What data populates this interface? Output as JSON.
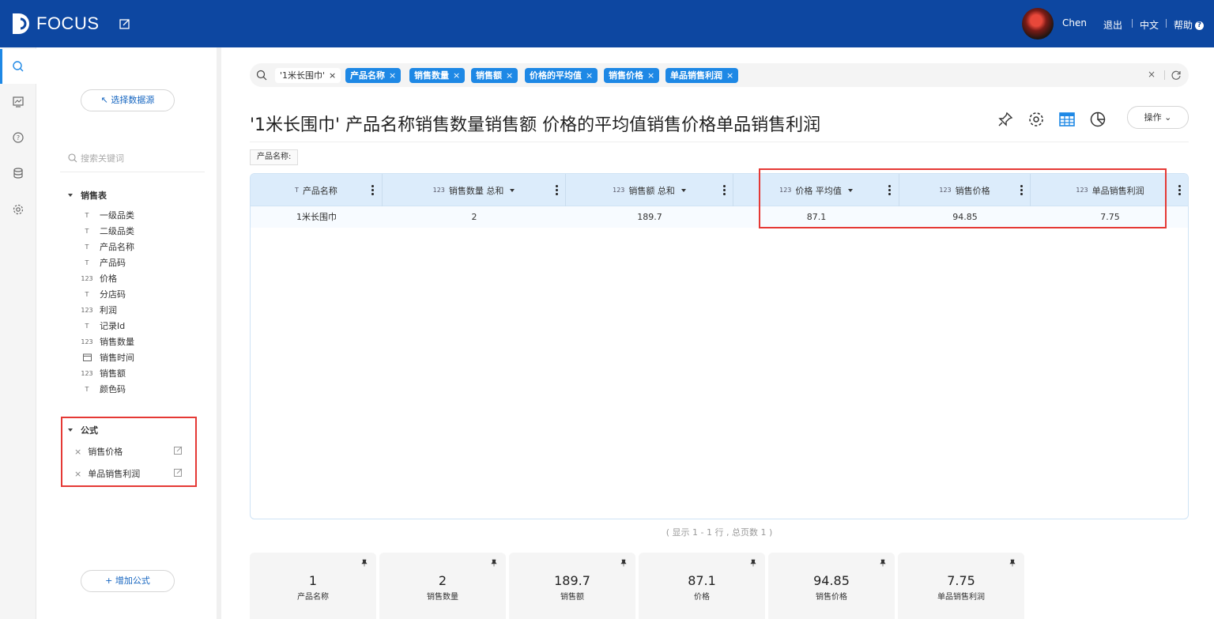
{
  "header": {
    "logo_text": "FOCUS",
    "user_name": "Chen",
    "logout": "退出",
    "language": "中文",
    "help": "帮助"
  },
  "sidebar": {
    "select_source": "↖ 选择数据源",
    "search_placeholder": "搜索关键词",
    "table_name": "销售表",
    "fields": [
      {
        "type": "text",
        "label": "一级品类"
      },
      {
        "type": "text",
        "label": "二级品类"
      },
      {
        "type": "text",
        "label": "产品名称"
      },
      {
        "type": "text",
        "label": "产品码"
      },
      {
        "type": "number",
        "label": "价格"
      },
      {
        "type": "text",
        "label": "分店码"
      },
      {
        "type": "number",
        "label": "利润"
      },
      {
        "type": "text",
        "label": "记录Id"
      },
      {
        "type": "number",
        "label": "销售数量"
      },
      {
        "type": "date",
        "label": "销售时间"
      },
      {
        "type": "number",
        "label": "销售额"
      },
      {
        "type": "text",
        "label": "颜色码"
      }
    ],
    "formula_section": "公式",
    "formulas": [
      "销售价格",
      "单品销售利润"
    ],
    "add_formula": "+ 增加公式"
  },
  "search": {
    "chips": [
      {
        "label": "'1米长围巾'",
        "style": "light"
      },
      {
        "label": "产品名称",
        "style": "blue"
      },
      {
        "label": "销售数量",
        "style": "blue"
      },
      {
        "label": "销售额",
        "style": "blue"
      },
      {
        "label": "价格的平均值",
        "style": "blue"
      },
      {
        "label": "销售价格",
        "style": "blue"
      },
      {
        "label": "单品销售利润",
        "style": "blue"
      }
    ],
    "clear": "×"
  },
  "main": {
    "title": "'1米长围巾' 产品名称销售数量销售额 价格的平均值销售价格单品销售利润",
    "ops_button": "操作",
    "filter_tag": "产品名称:"
  },
  "table": {
    "columns": [
      {
        "icon": "T",
        "label": "产品名称",
        "sort": false
      },
      {
        "icon": "123",
        "label": "销售数量 总和",
        "sort": true
      },
      {
        "icon": "123",
        "label": "销售额 总和",
        "sort": true
      },
      {
        "icon": "123",
        "label": "价格 平均值",
        "sort": true
      },
      {
        "icon": "123",
        "label": "销售价格",
        "sort": false
      },
      {
        "icon": "123",
        "label": "单品销售利润",
        "sort": false
      }
    ],
    "rows": [
      [
        "1米长围巾",
        "2",
        "189.7",
        "87.1",
        "94.85",
        "7.75"
      ]
    ],
    "pager": "( 显示 1 - 1 行 , 总页数 1 )"
  },
  "summary_cards": [
    {
      "value": "1",
      "label": "产品名称"
    },
    {
      "value": "2",
      "label": "销售数量"
    },
    {
      "value": "189.7",
      "label": "销售额"
    },
    {
      "value": "87.1",
      "label": "价格"
    },
    {
      "value": "94.85",
      "label": "销售价格"
    },
    {
      "value": "7.75",
      "label": "单品销售利润"
    }
  ],
  "colors": {
    "header_bg": "#0d47a1",
    "chip_blue": "#1e88e5",
    "highlight_red": "#e53935"
  }
}
